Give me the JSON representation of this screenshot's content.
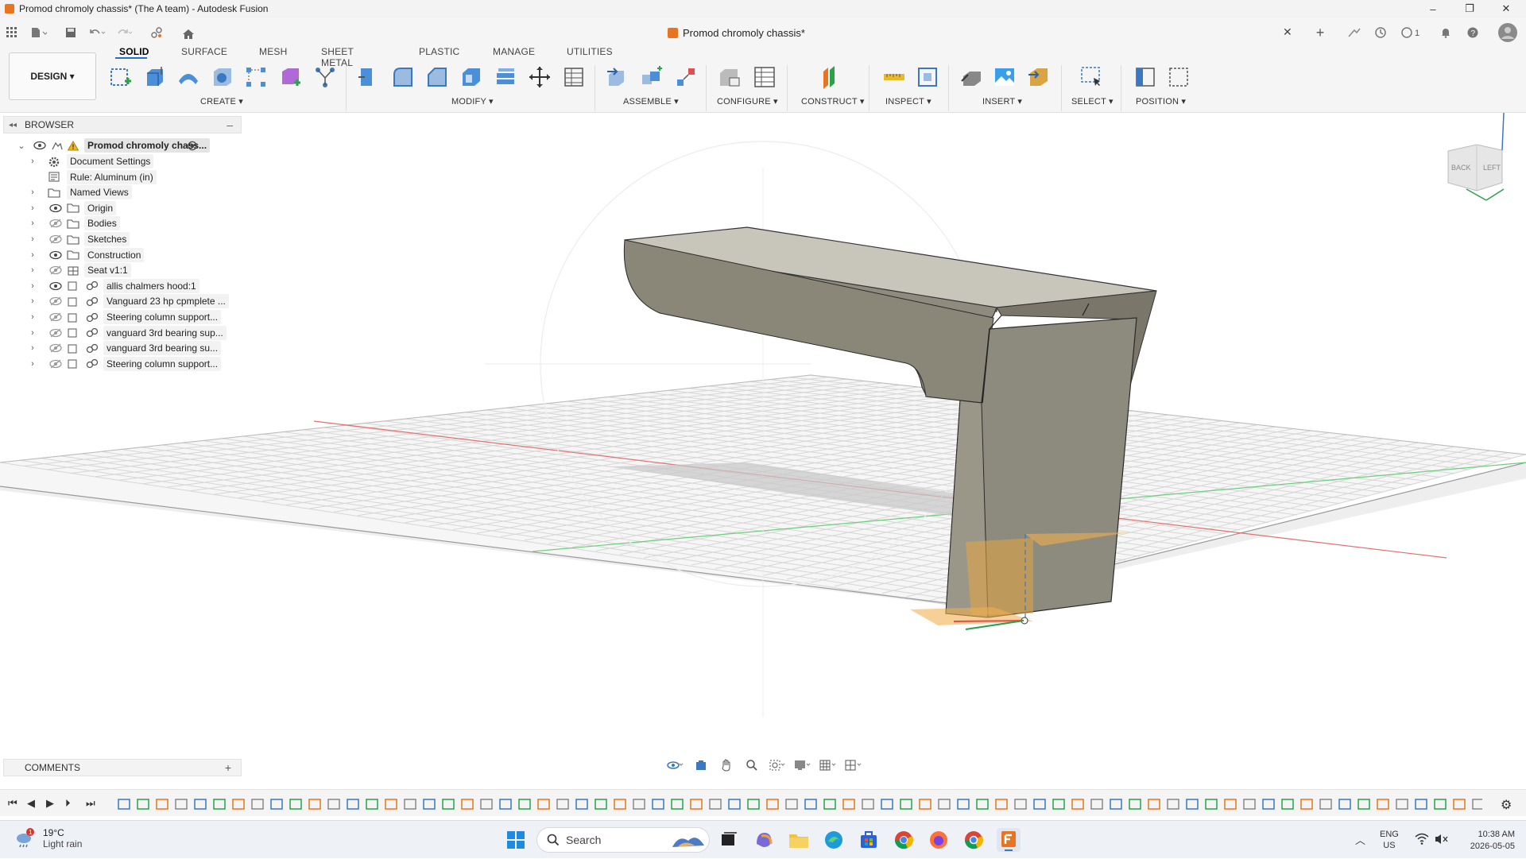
{
  "window": {
    "title": "Promod chromoly chassis* (The A team) - Autodesk Fusion",
    "controls": {
      "minimize": "–",
      "maximize": "❐",
      "close": "✕"
    }
  },
  "document_tab": {
    "title": "Promod chromoly chassis*",
    "close": "✕",
    "new_tab": "+"
  },
  "workspace": {
    "label": "DESIGN ▾"
  },
  "ribbon": {
    "tabs": [
      "SOLID",
      "SURFACE",
      "MESH",
      "SHEET METAL",
      "PLASTIC",
      "MANAGE",
      "UTILITIES"
    ],
    "active_tab": "SOLID",
    "groups": {
      "create": "CREATE ▾",
      "modify": "MODIFY ▾",
      "assemble": "ASSEMBLE ▾",
      "configure": "CONFIGURE ▾",
      "construct": "CONSTRUCT ▾",
      "inspect": "INSPECT ▾",
      "insert": "INSERT ▾",
      "select": "SELECT ▾",
      "position": "POSITION ▾"
    }
  },
  "browser": {
    "title": "BROWSER",
    "root": "Promod chromoly chass...",
    "items": [
      {
        "label": "Document Settings",
        "icon": "gear-icon"
      },
      {
        "label": "Rule: Aluminum (in)",
        "icon": "rule-icon"
      },
      {
        "label": "Named Views",
        "icon": "folder-icon"
      },
      {
        "label": "Origin",
        "icon": "folder-icon"
      },
      {
        "label": "Bodies",
        "icon": "folder-icon"
      },
      {
        "label": "Sketches",
        "icon": "folder-icon"
      },
      {
        "label": "Construction",
        "icon": "folder-icon"
      },
      {
        "label": "Seat v1:1",
        "icon": "component-icon"
      },
      {
        "label": "allis chalmers hood:1",
        "icon": "link-icon"
      },
      {
        "label": "Vanguard 23 hp cpmplete ...",
        "icon": "link-icon"
      },
      {
        "label": "Steering column support...",
        "icon": "link-icon"
      },
      {
        "label": "vanguard 3rd bearing sup...",
        "icon": "link-icon"
      },
      {
        "label": "vanguard 3rd bearing su...",
        "icon": "link-icon"
      },
      {
        "label": "Steering column support...",
        "icon": "link-icon"
      }
    ]
  },
  "viewcube": {
    "back": "BACK",
    "left": "LEFT",
    "axis": "Z"
  },
  "comments": {
    "label": "COMMENTS",
    "add": "+"
  },
  "taskbar": {
    "weather": {
      "temp": "19°C",
      "condition": "Light rain",
      "badge": "1"
    },
    "search_placeholder": "Search",
    "language": {
      "lang": "ENG",
      "region": "US"
    },
    "clock": {
      "time": "10:38 AM",
      "date": "2026-05-05"
    }
  },
  "colors": {
    "accent": "#e8741f",
    "body": "#8a8678",
    "body_top": "#c2bfb4",
    "x_axis": "#e05050",
    "y_axis": "#40c060"
  }
}
